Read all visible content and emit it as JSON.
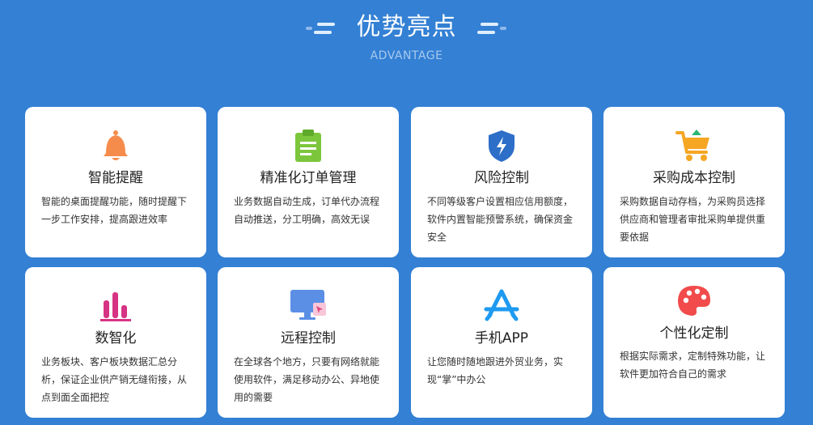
{
  "header": {
    "title": "优势亮点",
    "subtitle": "ADVANTAGE"
  },
  "colors": {
    "background": "#3380d4",
    "card": "#ffffff",
    "bell": "#f58c4c",
    "clipboard": "#7cc63c",
    "shield": "#2d6ec8",
    "cart": "#f5a623",
    "chart": "#d63384",
    "monitor": "#5b8fe6",
    "app": "#1e9af0",
    "palette": "#f24b4b"
  },
  "cards": [
    {
      "title": "智能提醒",
      "desc": "智能的桌面提醒功能，随时提醒下一步工作安排，提高跟进效率",
      "icon": "bell-icon"
    },
    {
      "title": "精准化订单管理",
      "desc": "业务数据自动生成，订单代办流程自动推送，分工明确，高效无误",
      "icon": "clipboard-icon"
    },
    {
      "title": "风险控制",
      "desc": "不同等级客户设置相应信用额度，软件内置智能预警系统，确保资金安全",
      "icon": "shield-icon"
    },
    {
      "title": "采购成本控制",
      "desc": "采购数据自动存档，为采购员选择供应商和管理者审批采购单提供重要依据",
      "icon": "cart-icon"
    },
    {
      "title": "数智化",
      "desc": "业务板块、客户板块数据汇总分析，保证企业供产销无缝衔接，从点到面全面把控",
      "icon": "bar-chart-icon"
    },
    {
      "title": "远程控制",
      "desc": "在全球各个地方，只要有网络就能使用软件，满足移动办公、异地使用的需要",
      "icon": "monitor-icon"
    },
    {
      "title": "手机APP",
      "desc": "让您随时随地跟进外贸业务，实现“掌”中办公",
      "icon": "app-store-icon"
    },
    {
      "title": "个性化定制",
      "desc": "根据实际需求，定制特殊功能，让软件更加符合自己的需求",
      "icon": "palette-icon"
    }
  ]
}
